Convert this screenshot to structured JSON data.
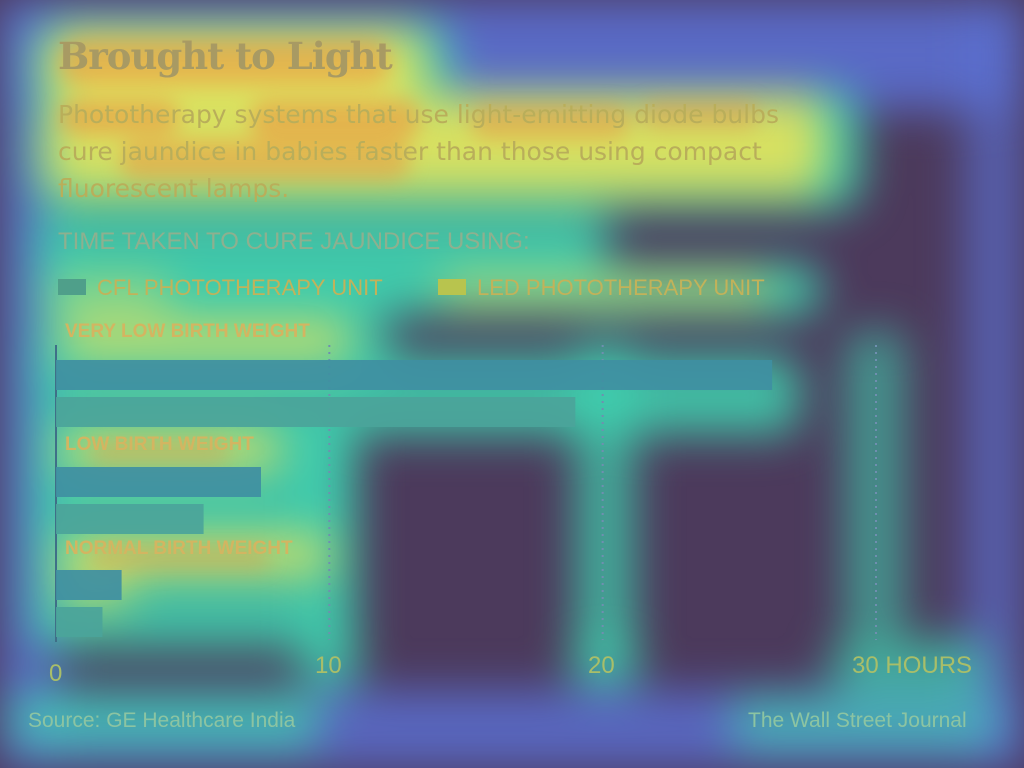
{
  "header": {
    "title": "Brought to Light",
    "subtitle_lines": [
      "Phototherapy systems that use light-emitting diode bulbs",
      "cure jaundice in babies faster than those using compact",
      "fluorescent lamps."
    ]
  },
  "chart_data": {
    "type": "bar",
    "orientation": "horizontal",
    "title": "Brought to Light",
    "section_label": "TIME TAKEN TO CURE JAUNDICE USING:",
    "categories": [
      "VERY LOW BIRTH WEIGHT",
      "LOW BIRTH WEIGHT",
      "NORMAL BIRTH WEIGHT"
    ],
    "series": [
      {
        "name": "CFL PHOTOTHERAPY UNIT",
        "values": [
          26.2,
          7.5,
          2.4
        ],
        "color": "#3f8fa2"
      },
      {
        "name": "LED PHOTOTHERAPY UNIT",
        "values": [
          19.0,
          5.4,
          1.7
        ],
        "color": "#4ba49a"
      }
    ],
    "xlim": [
      0,
      30
    ],
    "xticks": [
      "0",
      "10",
      "20",
      "30 HOURS"
    ],
    "xtick_values": [
      0,
      10,
      20,
      30
    ],
    "grid": "vertical dotted",
    "legend": "top-left"
  },
  "footer": {
    "source": "Source: GE Healthcare India",
    "publisher": "The Wall Street Journal"
  },
  "colors": {
    "background": "#4c3a5c",
    "heat_low": "#5b6fd0",
    "heat_mid": "#3fd4b0",
    "heat_high": "#e8e25a",
    "heat_peak": "#f0883a"
  }
}
